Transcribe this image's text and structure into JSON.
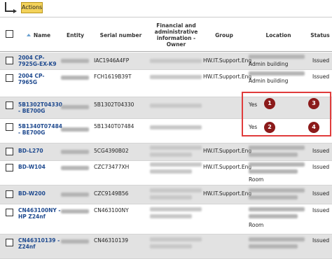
{
  "toolbar": {
    "actions_label": "Actions"
  },
  "columns": {
    "name": "Name",
    "entity": "Entity",
    "serial": "Serial number",
    "owner": "Financial and administrative information - Owner",
    "group": "Group",
    "location": "Location",
    "status": "Status"
  },
  "rows": [
    {
      "name": "2004 CP-7925G-EX-K9",
      "serial": "IAC1946A4FP",
      "group": "HW.IT.Support.Eng",
      "location": "Admin building",
      "status": "Issued"
    },
    {
      "name": "2004 CP-7965G",
      "serial": "FCH1619B39T",
      "group": "HW.IT.Support.Eng",
      "location": "Admin building",
      "status": "Issued"
    },
    {
      "name": "5B1302T04330 - BE700G",
      "serial": "5B1302T04330",
      "group": "",
      "location": "Yes",
      "status": ""
    },
    {
      "name": "5B1340T07484 - BE700G",
      "serial": "5B1340T07484",
      "group": "",
      "location": "Yes",
      "status": ""
    },
    {
      "name": "BD-L270",
      "serial": "5CG4390B02",
      "group": "HW.IT.Support.Eng",
      "location": "",
      "status": "Issued"
    },
    {
      "name": "BD-W104",
      "serial": "CZC73477XH",
      "group": "HW.IT.Support.Eng",
      "location": "Room",
      "status": "Issued"
    },
    {
      "name": "BD-W200",
      "serial": "CZC9149B56",
      "group": "HW.IT.Support.Eng",
      "location": "",
      "status": "Issued"
    },
    {
      "name": "CN463100NY - HP Z24nf",
      "serial": "CN463100NY",
      "group": "",
      "location": "Room",
      "status": "Issued"
    },
    {
      "name": "CN46310139 - Z24nf",
      "serial": "CN46310139",
      "group": "",
      "location": "",
      "status": "Issued"
    }
  ],
  "annotations": [
    "1",
    "2",
    "3",
    "4"
  ],
  "colors": {
    "actions_bg": "#f3d25a",
    "link": "#1f4a8f",
    "highlight_border": "#e03c3c",
    "badge": "#8b1a1a"
  }
}
